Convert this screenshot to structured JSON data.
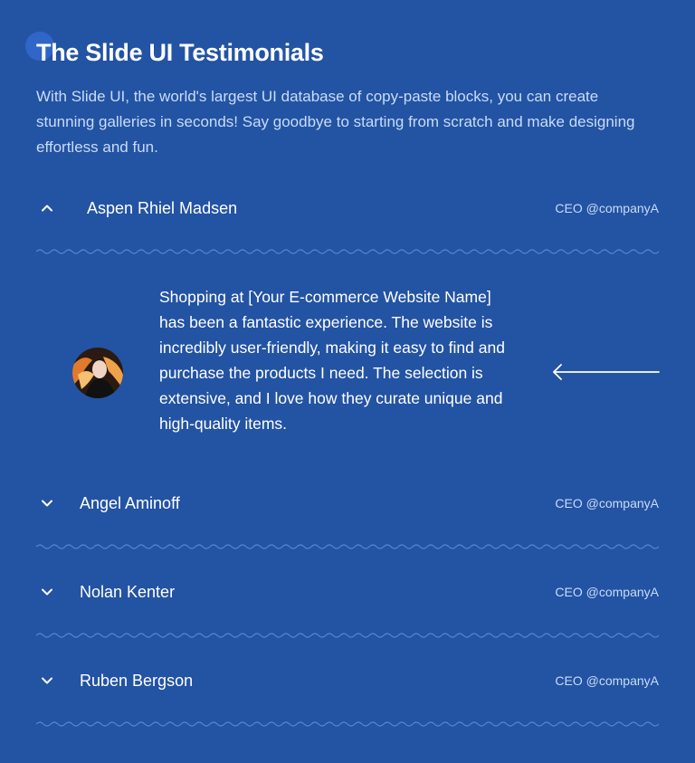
{
  "header": {
    "title": "The Slide UI Testimonials",
    "intro": "With Slide UI, the world's largest UI database of copy-paste blocks, you can create stunning galleries in seconds! Say goodbye to starting from scratch and make designing effortless and fun."
  },
  "testimonials": [
    {
      "name": "Aspen Rhiel Madsen",
      "role": "CEO @companyA",
      "expanded": true,
      "quote": "Shopping at [Your E-commerce Website Name] has been a fantastic experience. The website is incredibly user-friendly, making it easy to find and purchase the products I need. The selection is extensive, and I love how they curate unique and high-quality items."
    },
    {
      "name": "Angel Aminoff",
      "role": "CEO @companyA",
      "expanded": false
    },
    {
      "name": "Nolan Kenter",
      "role": "CEO @companyA",
      "expanded": false
    },
    {
      "name": "Ruben Bergson",
      "role": "CEO @companyA",
      "expanded": false
    }
  ],
  "icons": {
    "expanded_item": "chevron-up-icon",
    "collapsed_item": "chevron-down-icon",
    "quote_action": "arrow-left-icon",
    "divider": "wavy-line"
  },
  "colors": {
    "background": "#2353a3",
    "text": "#ffffff",
    "muted_text": "#c8dcf7",
    "divider": "#4f86d6"
  }
}
